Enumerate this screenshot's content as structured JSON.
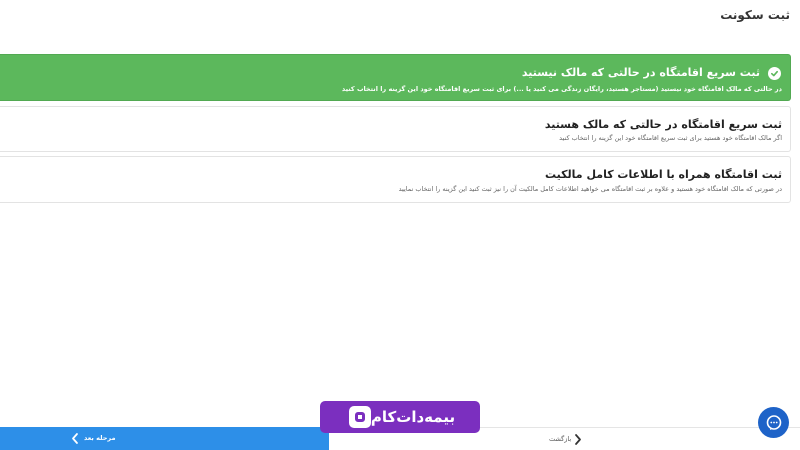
{
  "page": {
    "title": "ثبت سکونت"
  },
  "options": [
    {
      "title": "ثبت سریع اقامتگاه در حالتی که مالک نیستید",
      "description": "در حالتی که مالک اقامتگاه خود نیستید (مستاجر هستید، رایگان زندگی می کنید یا ...) برای ثبت سریع اقامتگاه خود این گزینه را انتخاب کنید",
      "selected": true
    },
    {
      "title": "ثبت سریع اقامتگاه در حالتی که مالک هستید",
      "description": "اگر مالک اقامتگاه خود هستید برای ثبت سریع اقامتگاه خود این گزینه را انتخاب کنید",
      "selected": false
    },
    {
      "title": "ثبت اقامتگاه همراه با اطلاعات کامل مالکیت",
      "description": "در صورتی که مالک اقامتگاه خود هستید و علاوه بر ثبت اقامتگاه می خواهید اطلاعات کامل مالکیت آن را نیز ثبت کنید این گزینه را انتخاب نمایید",
      "selected": false
    }
  ],
  "footer": {
    "next_label": "مرحله بعد",
    "back_label": "بازگشت"
  },
  "logo": {
    "text": "بیمه‌دات‌کام"
  },
  "colors": {
    "selected": "#5cb85c",
    "primary": "#2d8fe8",
    "brand": "#7b2fbf",
    "chat": "#1e63c8"
  },
  "icons": [
    "check-circle-icon",
    "chevron-left-icon",
    "chevron-right-icon",
    "chat-icon"
  ]
}
